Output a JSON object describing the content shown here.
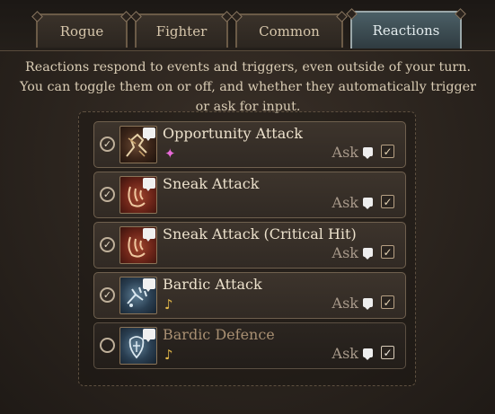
{
  "tabs": [
    {
      "label": "Rogue",
      "active": false
    },
    {
      "label": "Fighter",
      "active": false
    },
    {
      "label": "Common",
      "active": false
    },
    {
      "label": "Reactions",
      "active": true
    }
  ],
  "description": "Reactions respond to events and triggers, even outside of your turn. You can toggle them on or off, and whether they automatically trigger or ask for input.",
  "reactions": [
    {
      "name": "Opportunity Attack",
      "icon": "opportunity-attack-icon",
      "resource_icon": "✦",
      "resource_name": "spark-icon",
      "resource_color": "#e86ad8",
      "enabled": true,
      "ask_label": "Ask",
      "ask_checked": true
    },
    {
      "name": "Sneak Attack",
      "icon": "sneak-attack-icon",
      "resource_icon": "",
      "resource_name": "",
      "resource_color": "",
      "enabled": true,
      "ask_label": "Ask",
      "ask_checked": true
    },
    {
      "name": "Sneak Attack (Critical Hit)",
      "icon": "sneak-attack-icon",
      "resource_icon": "",
      "resource_name": "",
      "resource_color": "",
      "enabled": true,
      "ask_label": "Ask",
      "ask_checked": true
    },
    {
      "name": "Bardic Attack",
      "icon": "bardic-attack-icon",
      "resource_icon": "♪",
      "resource_name": "music-note-icon",
      "resource_color": "#e2b84a",
      "enabled": true,
      "ask_label": "Ask",
      "ask_checked": true
    },
    {
      "name": "Bardic Defence",
      "icon": "bardic-defence-icon",
      "resource_icon": "♪",
      "resource_name": "music-note-icon",
      "resource_color": "#e2b84a",
      "enabled": false,
      "ask_label": "Ask",
      "ask_checked": true
    }
  ],
  "check_glyph": "✓",
  "colors": {
    "active_tab": "#4b5f66",
    "text": "#d9ccb4",
    "disabled_title": "#a88f72"
  }
}
